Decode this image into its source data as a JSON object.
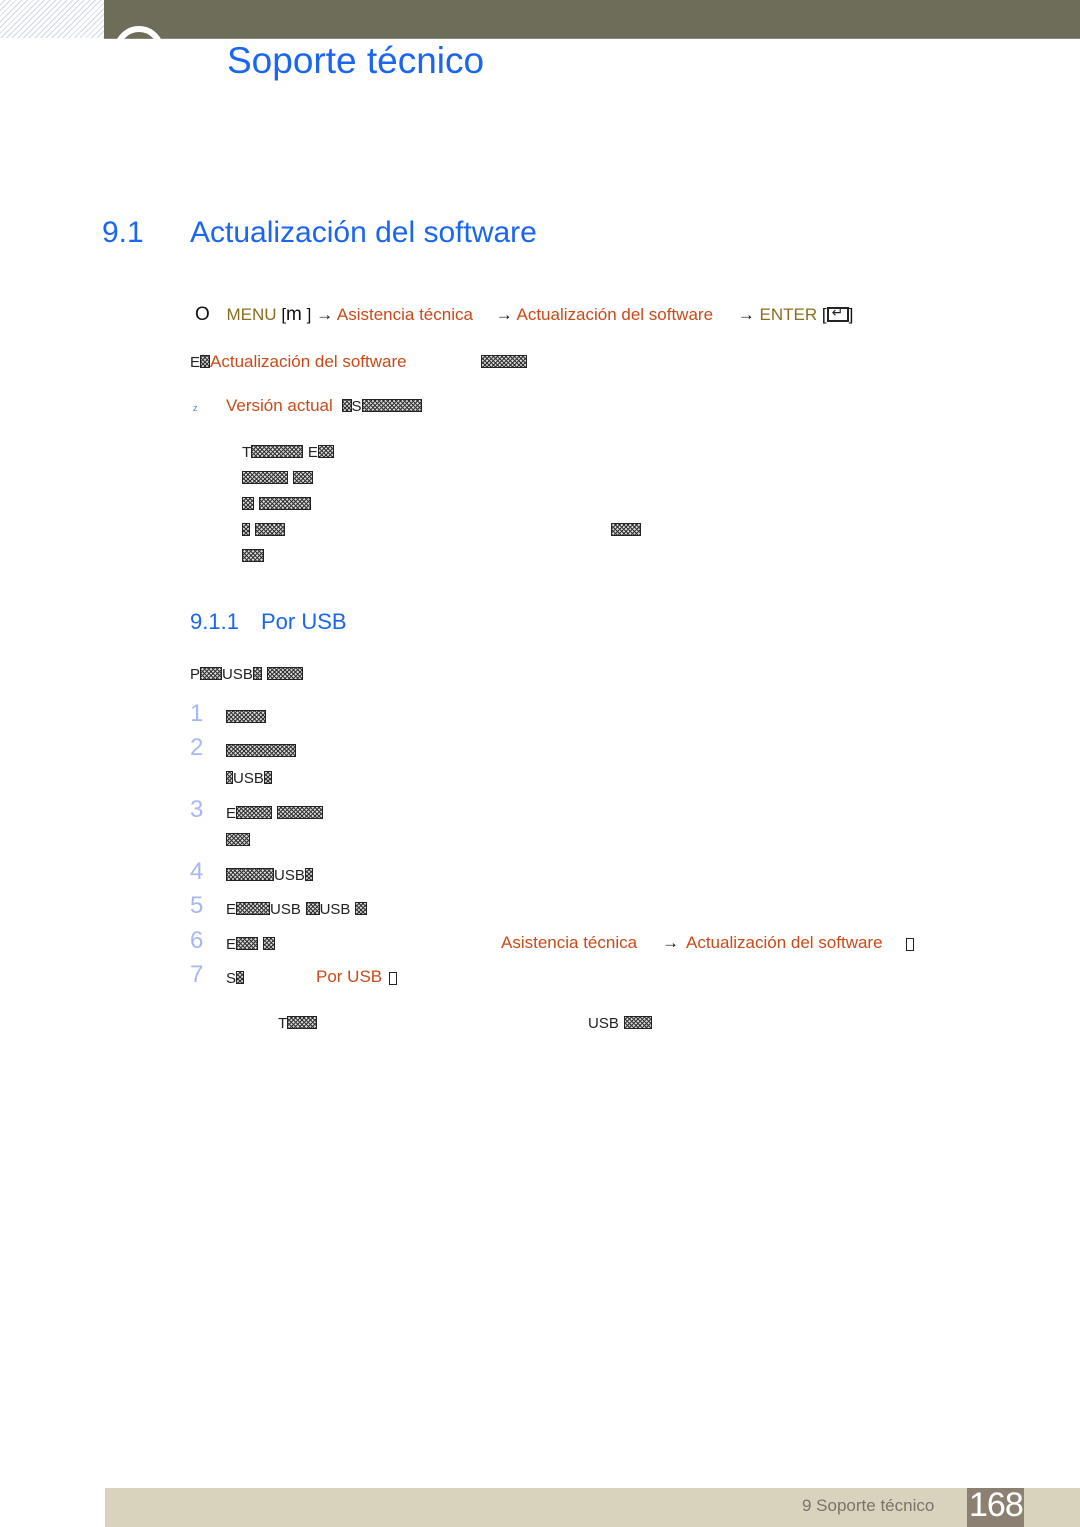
{
  "header": {
    "chapter_title": "Soporte técnico"
  },
  "section": {
    "number": "9.1",
    "title": "Actualización del software"
  },
  "menu_path": {
    "lead_icon": "O",
    "menu_label": "MENU",
    "menu_key": "m",
    "arrow": "→",
    "step1": "Asistencia técnica",
    "step2": "Actualización del software",
    "enter_label": "ENTER",
    "bracket_open": "[",
    "bracket_close": "]"
  },
  "intro": {
    "prefix": "E",
    "link": "Actualización del software"
  },
  "version": {
    "bullet": "z",
    "label": "Versión actual",
    "suffix": "S"
  },
  "paragraph_lines": [
    {
      "lead": "T",
      "mid": "E"
    },
    {
      "lead": "",
      "mid": ""
    },
    {
      "lead": "",
      "mid": ""
    },
    {
      "lead": "",
      "mid": ""
    },
    {
      "lead": "",
      "mid": ""
    }
  ],
  "subsection": {
    "number": "9.1.1",
    "title": "Por USB"
  },
  "usb_intro": {
    "lead": "P",
    "usb": "USB"
  },
  "steps": [
    {
      "num": "1",
      "text": ""
    },
    {
      "num": "2",
      "text": "",
      "line2": "USB"
    },
    {
      "num": "3",
      "text": "E"
    },
    {
      "num": "4",
      "text": "USB"
    },
    {
      "num": "5",
      "text": "E",
      "usb_a": "USB",
      "usb_b": "USB"
    },
    {
      "num": "6",
      "text": "E",
      "link1": "Asistencia técnica",
      "arrow": "→",
      "link2": "Actualización del software"
    },
    {
      "num": "7",
      "text": "S",
      "link": "Por USB"
    }
  ],
  "note": {
    "lead": "T",
    "usb": "USB"
  },
  "footer": {
    "chapter_label": "9 Soporte técnico",
    "page_number": "168"
  }
}
